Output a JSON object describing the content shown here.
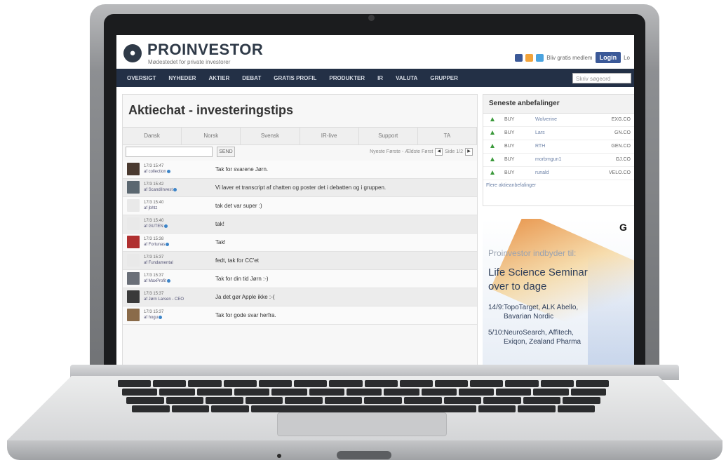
{
  "site": {
    "brand": "PROINVESTOR",
    "tagline": "Mødestedet for private investorer",
    "signup_text": "Bliv gratis medlem",
    "login_label": "Login",
    "header_extra": "Lo"
  },
  "nav": {
    "items": [
      "OVERSIGT",
      "NYHEDER",
      "AKTIER",
      "DEBAT",
      "GRATIS PROFIL",
      "PRODUKTER",
      "IR",
      "VALUTA",
      "GRUPPER"
    ],
    "search_placeholder": "Skriv søgeord"
  },
  "chat": {
    "title": "Aktiechat - investeringstips",
    "tabs": [
      "Dansk",
      "Norsk",
      "Svensk",
      "IR-live",
      "Support",
      "TA"
    ],
    "send_label": "SEND",
    "pager_text": "Nyeste Første - Ældste Først",
    "page_label": "Side 1/2",
    "messages": [
      {
        "time": "17/3 15:47",
        "user": "af collection",
        "text": "Tak for svarene Jørn.",
        "avatar": "#4a3a30"
      },
      {
        "time": "17/3 15:42",
        "user": "af ScandiInvest",
        "text": "Vi laver et transcript af chatten og poster det i debatten og i gruppen.",
        "avatar": "#5b6770"
      },
      {
        "time": "17/3 15:40",
        "user": "af jbhtz",
        "text": "tak det var super :)",
        "avatar": "#e9e9e9"
      },
      {
        "time": "17/3 15:40",
        "user": "af GUTEN",
        "text": "tak!",
        "avatar": "#e9e9e9"
      },
      {
        "time": "17/3 15:38",
        "user": "af Fortunas",
        "text": "Tak!",
        "avatar": "#b03030"
      },
      {
        "time": "17/3 15:37",
        "user": "af Fundamental",
        "text": "fedt, tak for CC'et",
        "avatar": "#e9e9e9"
      },
      {
        "time": "17/3 15:37",
        "user": "af MaxProfit",
        "text": "Tak for din tid Jørn :-)",
        "avatar": "#6a6f78"
      },
      {
        "time": "17/3 15:37",
        "user": "af Jørn Larsen - CEO",
        "text": "Ja det gør Apple ikke :-(",
        "avatar": "#3a3a3a"
      },
      {
        "time": "17/3 15:37",
        "user": "af hogu",
        "text": "Tak for gode svar herfra.",
        "avatar": "#8a6b4a"
      }
    ]
  },
  "recommendations": {
    "title": "Seneste anbefalinger",
    "rows": [
      {
        "action": "BUY",
        "name": "Wolverine",
        "ticker": "EXG.CO"
      },
      {
        "action": "BUY",
        "name": "Lars",
        "ticker": "GN.CO"
      },
      {
        "action": "BUY",
        "name": "RTH",
        "ticker": "GEN.CO"
      },
      {
        "action": "BUY",
        "name": "morbmgun1",
        "ticker": "GJ.CO"
      },
      {
        "action": "BUY",
        "name": "runald",
        "ticker": "VELO.CO"
      }
    ],
    "more_link": "Flere aktieanbefalinger"
  },
  "ad": {
    "line1": "Proinvestor indbyder til:",
    "line2": "Life Science Seminar",
    "line3": "over to dage",
    "item1_date": "14/9:",
    "item1_a": "TopoTarget, ALK Abello,",
    "item1_b": "Bavarian Nordic",
    "item2_date": "5/10:",
    "item2_a": "NeuroSearch, Affitech,",
    "item2_b": "Exiqon, Zealand Pharma",
    "corner": "G"
  }
}
